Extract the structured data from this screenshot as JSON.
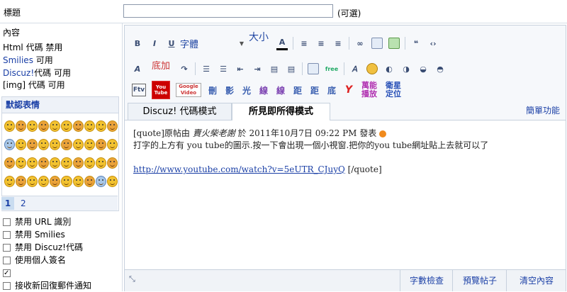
{
  "form": {
    "title_label": "標題",
    "title_input_value": "",
    "optional_note": "(可選)",
    "content_label": "內容",
    "rules": [
      {
        "name": "Html",
        "suffix": "代碼 禁用",
        "blue": false
      },
      {
        "name": "Smilies",
        "suffix": "可用",
        "blue": true
      },
      {
        "name": "Discuz!",
        "suffix": "代碼 可用",
        "blue": true
      },
      {
        "name": "[img]",
        "suffix": "代碼 可用",
        "blue": false
      }
    ]
  },
  "smilies": {
    "header": "默認表情",
    "pages": [
      "1",
      "2"
    ],
    "active_page": "1"
  },
  "options": [
    {
      "label": "禁用 URL 識別",
      "checked": false
    },
    {
      "label": "禁用 Smilies",
      "checked": false
    },
    {
      "label": "禁用 Discuz!代碼",
      "checked": false
    },
    {
      "label": "使用個人簽名",
      "checked": false
    },
    {
      "label": "",
      "checked": true
    },
    {
      "label": "接收新回復郵件通知",
      "checked": false
    }
  ],
  "toolbar": {
    "bold": "B",
    "italic": "I",
    "underline": "U",
    "font_label": "字體",
    "size_label": "大小",
    "color_label": "A",
    "row2_badge": "底加",
    "free_label": "free",
    "row3_video_label": "Google Video",
    "youtube_label": "You Tube",
    "ftv_label": "Ftv",
    "row3_text": [
      "刪",
      "影",
      "光",
      "線",
      "線",
      "距",
      "距",
      "底"
    ],
    "special1": "萬能播放",
    "special2": "衛星定位"
  },
  "tabs": {
    "discuz": "Discuz! 代碼模式",
    "wysiwyg": "所見即所得模式",
    "simple": "簡單功能"
  },
  "editor_content": {
    "quote_prefix": "[quote]原帖由",
    "author": "賣火柴老謝",
    "at": "於",
    "datetime": "2011年10月7日 09:22 PM",
    "posted": "發表",
    "body": "打字的上方有 you tube的圖示.按一下會出現一個小視窗.把你的you tube網址貼上去就可以了",
    "link": "http://www.youtube.com/watch?v=5eUTR_CJuyQ",
    "quote_end": "[/quote]"
  },
  "bottom": {
    "count": "字數檢查",
    "preview": "預覽帖子",
    "clear": "清空內容"
  }
}
